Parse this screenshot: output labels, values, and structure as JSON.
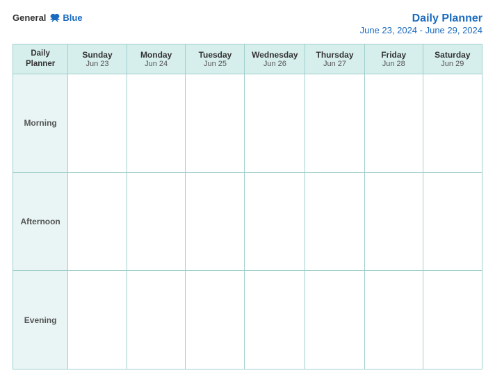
{
  "header": {
    "logo": {
      "general": "General",
      "blue": "Blue"
    },
    "title": "Daily Planner",
    "subtitle": "June 23, 2024 - June 29, 2024"
  },
  "table": {
    "header_label_line1": "Daily",
    "header_label_line2": "Planner",
    "columns": [
      {
        "day": "Sunday",
        "date": "Jun 23"
      },
      {
        "day": "Monday",
        "date": "Jun 24"
      },
      {
        "day": "Tuesday",
        "date": "Jun 25"
      },
      {
        "day": "Wednesday",
        "date": "Jun 26"
      },
      {
        "day": "Thursday",
        "date": "Jun 27"
      },
      {
        "day": "Friday",
        "date": "Jun 28"
      },
      {
        "day": "Saturday",
        "date": "Jun 29"
      }
    ],
    "rows": [
      {
        "label": "Morning"
      },
      {
        "label": "Afternoon"
      },
      {
        "label": "Evening"
      }
    ]
  }
}
